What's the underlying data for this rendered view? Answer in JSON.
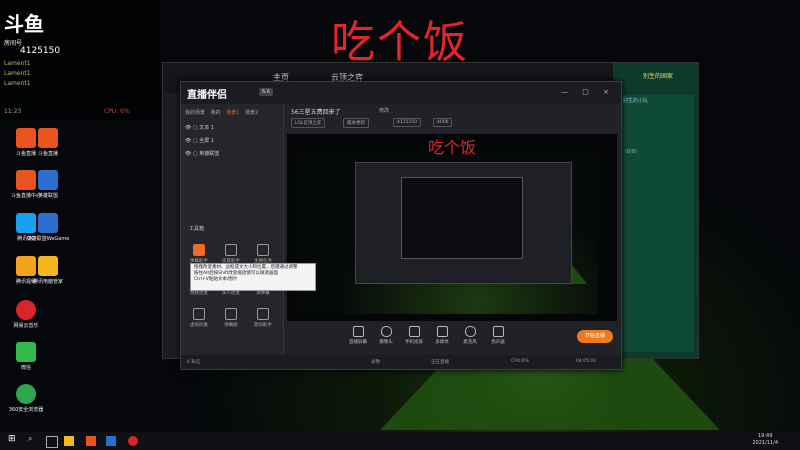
{
  "overlay_title": "吃个饭",
  "preview_title": "吃个饭",
  "stream_overlay": {
    "logo": "斗鱼",
    "room_label": "房间号",
    "room_number": "4125150",
    "line1": "Lament1",
    "line2": "Lament1",
    "line3": "Lament1",
    "stats_left": "11:23",
    "stats_right": "CPU: 6%"
  },
  "desktop_icons": [
    {
      "label": "斗鱼直播",
      "color": "#e8541b"
    },
    {
      "label": "斗鱼直播中心",
      "color": "#e8541b"
    },
    {
      "label": "腾讯QQ",
      "color": "#19a0f0"
    },
    {
      "label": "腾讯视频",
      "color": "#f3a21b"
    },
    {
      "label": "网易云音乐",
      "color": "#d9262a"
    },
    {
      "label": "微信",
      "color": "#33b94a"
    },
    {
      "label": "360安全浏览器",
      "color": "#2ea84a"
    },
    {
      "label": "斗鱼直播",
      "color": "#e8541b"
    },
    {
      "label": "英雄联盟",
      "color": "#2a6fd0"
    },
    {
      "label": "英雄联盟WeGame",
      "color": "#2a6fd0"
    },
    {
      "label": "腾讯电脑管家",
      "color": "#f4b81c"
    }
  ],
  "bg_client": {
    "tab_home": "主页",
    "tab_game": "云顶之弈",
    "side_name": "别生的国家",
    "side_sub": "别生的小队",
    "side_count": "(8/8)"
  },
  "app": {
    "logo": "直播伴侣",
    "version": "6.6",
    "window_buttons": "— □ ×",
    "left_tabs": [
      "我的场景",
      "我的",
      "场景1",
      "场景2"
    ],
    "scenes": [
      "文本 1",
      "全屏 1",
      "英雄联盟"
    ],
    "tools_title": "工具箱",
    "tools": [
      {
        "label": "弹幕助手",
        "hot": true
      },
      {
        "label": "房管助手",
        "hot": false
      },
      {
        "label": "主播任务",
        "hot": false
      },
      {
        "label": "视频连麦",
        "hot": false
      },
      {
        "label": "多人连麦",
        "hot": false
      },
      {
        "label": "调弹幕",
        "hot": false
      },
      {
        "label": "虚拟形象",
        "hot": false
      },
      {
        "label": "弹幕姬",
        "hot": false
      },
      {
        "label": "歌词助手",
        "hot": false
      }
    ],
    "room_title": "56三星五费回来了",
    "room_edit": "修改",
    "chips": [
      "LOL云顶之弈",
      "版本更新",
      "4125150",
      "4006"
    ],
    "tooltip_lines": [
      "拖拽改变素材、边框或文大小和位置，后键通过调整",
      "按住Alt后按Shift改变缩放使可以微调画面",
      "Ctrl+V粘贴文本/图片"
    ],
    "controls": [
      "直播屏幕",
      "摄像头",
      "手机投屏",
      "多媒体",
      "麦克风",
      "扬声器"
    ],
    "start_button": "开始直播",
    "status": [
      "6 私信",
      "录像",
      "正在直播",
      "CPU:6%",
      "04:05:01"
    ]
  },
  "taskbar": {
    "time": "19:49",
    "date": "2021/11/4"
  }
}
